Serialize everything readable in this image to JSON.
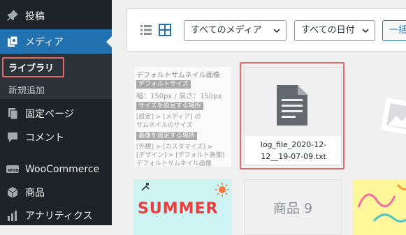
{
  "sidebar": {
    "items": [
      {
        "label": "投稿",
        "icon": "pin-icon"
      },
      {
        "label": "メディア",
        "icon": "media-icon"
      },
      {
        "label": "固定ページ",
        "icon": "pages-icon"
      },
      {
        "label": "コメント",
        "icon": "comment-icon"
      },
      {
        "label": "WooCommerce",
        "icon": "woocommerce-icon"
      },
      {
        "label": "商品",
        "icon": "box-icon"
      },
      {
        "label": "アナリティクス",
        "icon": "bar-chart-icon"
      }
    ],
    "submenu": {
      "library": "ライブラリ",
      "add_new": "新規追加"
    }
  },
  "toolbar": {
    "media_filter": "すべてのメディア",
    "date_filter": "すべての日付",
    "bulk_select": "一括"
  },
  "grid": {
    "default_thumb": {
      "title": "デフォルトサムネイル画像",
      "badge1": "デフォルトサイズ",
      "size_line": "幅：150px / 高さ：150px",
      "badge2": "サイズを設定する場所",
      "line2a": "[設定] > [メディア] の",
      "line2b": "サムネイルのサイズ",
      "badge3": "画像を設定する場所",
      "line3a": "[外観] > [カスタマイズ] >",
      "line3b": "[デザイン] > [デフォルト画像]",
      "line3c": "デフォルトサムネイル画像"
    },
    "file_tile": {
      "name_line1": "log_file_2020-12-",
      "name_line2": "12__19-07-09.txt"
    },
    "summer_tile": "SUMMER",
    "product_tile": "商品 9"
  },
  "colors": {
    "sidebar_bg": "#1d2327",
    "active_bg": "#2271b1",
    "highlight": "#e26a6a"
  }
}
